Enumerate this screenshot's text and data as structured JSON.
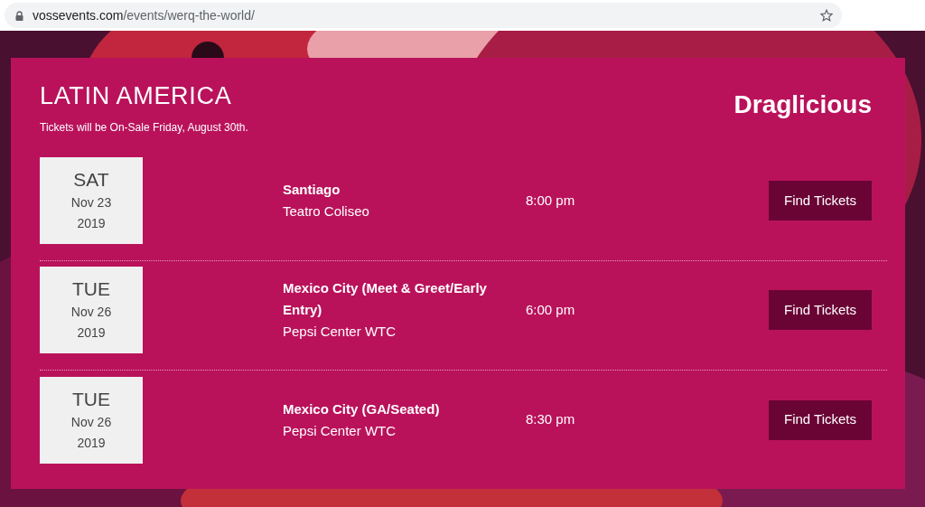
{
  "browser": {
    "url_host": "vossevents.com",
    "url_path": "/events/werq-the-world/"
  },
  "section": {
    "title": "LATIN AMERICA",
    "subtitle": "Tickets will be On-Sale Friday, August 30th.",
    "logo": "Draglicious"
  },
  "events": [
    {
      "weekday": "SAT",
      "date": "Nov 23",
      "year": "2019",
      "city": "Santiago",
      "venue": "Teatro Coliseo",
      "time": "8:00 pm",
      "button": "Find Tickets"
    },
    {
      "weekday": "TUE",
      "date": "Nov 26",
      "year": "2019",
      "city": "Mexico City (Meet & Greet/Early Entry)",
      "venue": "Pepsi Center WTC",
      "time": "6:00 pm",
      "button": "Find Tickets"
    },
    {
      "weekday": "TUE",
      "date": "Nov 26",
      "year": "2019",
      "city": "Mexico City (GA/Seated)",
      "venue": "Pepsi Center WTC",
      "time": "8:30 pm",
      "button": "Find Tickets"
    }
  ]
}
